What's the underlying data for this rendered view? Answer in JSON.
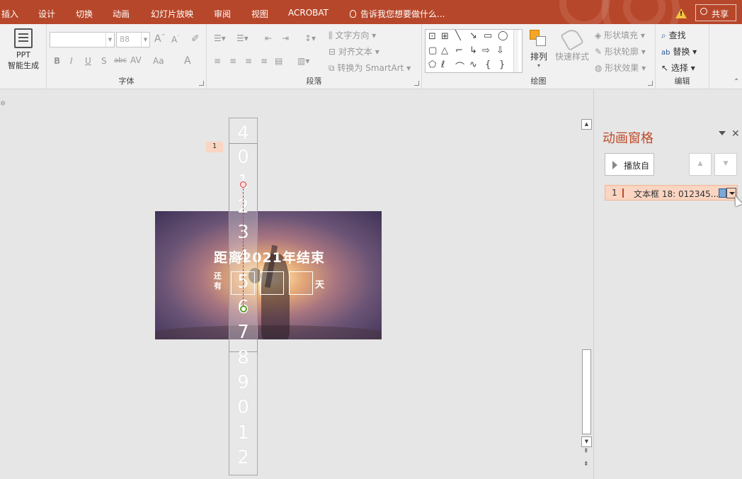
{
  "tabs": [
    "插入",
    "设计",
    "切换",
    "动画",
    "幻灯片放映",
    "审阅",
    "视图",
    "ACROBAT"
  ],
  "tell_me": "告诉我您想要做什么...",
  "share": "共享",
  "ribbon": {
    "ppt_btn": [
      "PPT",
      "智能生成"
    ],
    "font": {
      "name_value": "",
      "size_value": "88",
      "label": "字体"
    },
    "paragraph": {
      "label": "段落",
      "text_direction": "文字方向",
      "align_text": "对齐文本",
      "convert_smartart": "转换为 SmartArt"
    },
    "drawing": {
      "label": "绘图",
      "arrange": "排列",
      "quick_styles": "快速样式",
      "shape_fill": "形状填充",
      "shape_outline": "形状轮廓",
      "shape_effects": "形状效果"
    },
    "editing": {
      "label": "编辑",
      "find": "查找",
      "replace": "替换",
      "select": "选择"
    }
  },
  "slide": {
    "headline": "距离2021年结束",
    "still": "还有",
    "day": "天",
    "anim_tag": "1",
    "digits": [
      "4",
      "0",
      "1",
      "2",
      "3",
      "4",
      "5",
      "6",
      "7",
      "8",
      "9",
      "0",
      "1",
      "2"
    ]
  },
  "animation_pane": {
    "title": "动画窗格",
    "play_btn": "播放自",
    "item_num": "1",
    "item_label": "文本框 18: 012345..."
  },
  "colors": {
    "accent": "#b7472a",
    "pane_title": "#c04a29",
    "selection": "#f9d5c2"
  }
}
